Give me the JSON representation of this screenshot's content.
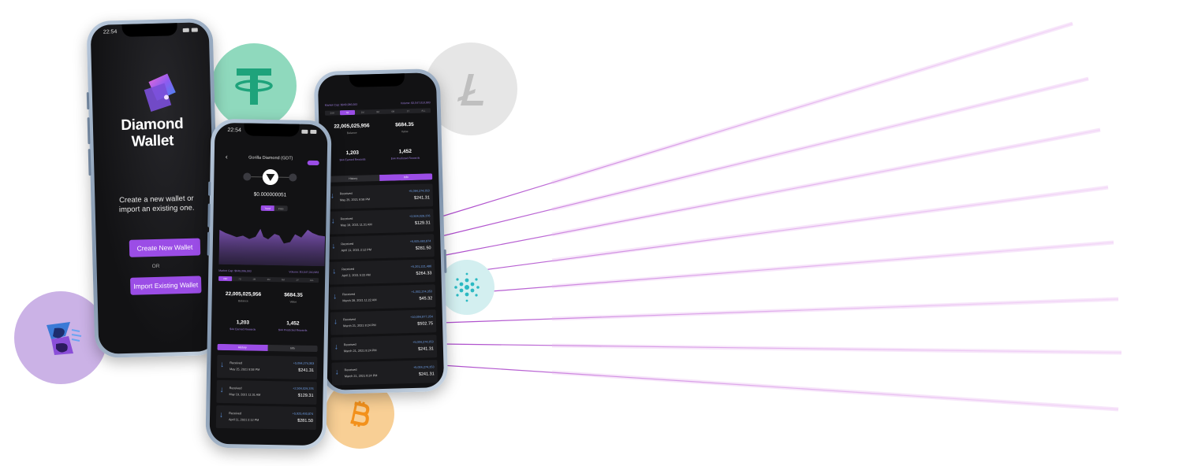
{
  "colors": {
    "accent": "#9b4de6",
    "ray": "#c65bd2",
    "tether": "#8fd9bd",
    "litecoin": "#e3e3e3",
    "bitcoin": "#f7c77d",
    "cardano": "#d3eff0",
    "bubble_purple": "#cbb2e6"
  },
  "coins": [
    {
      "name": "tether-icon"
    },
    {
      "name": "litecoin-icon"
    },
    {
      "name": "bitcoin-icon"
    },
    {
      "name": "cardano-icon"
    },
    {
      "name": "brand-icon"
    }
  ],
  "phone1": {
    "time": "22:54",
    "brand_line1": "Diamond",
    "brand_line2": "Wallet",
    "tagline_line1": "Create a new wallet or",
    "tagline_line2": "import an existing one.",
    "create_label": "Create New Wallet",
    "or_label": "OR",
    "import_label": "Import Existing Wallet"
  },
  "phone2": {
    "time": "22:54",
    "back": "‹",
    "title": "Gorilla Diamond (GDT)",
    "value": "$0.000000051",
    "toggle": [
      "Trend",
      "Price"
    ],
    "market_cap": "Market Cap: $849,086,083",
    "volume": "Volume: $3,547,010,983",
    "timeframes": [
      "24H",
      "7D",
      "1M",
      "3M",
      "6M",
      "1Y",
      "ALL"
    ],
    "balance_value": "22,005,025,956",
    "balance_label": "Balance",
    "value_value": "$684.35",
    "value_label": "Value",
    "earned_value": "1,203",
    "earned_label": "$44 Earned Rewards",
    "predicted_value": "1,452",
    "predicted_label": "$44 Predicted Rewards",
    "tabs": [
      "History",
      "Info"
    ],
    "transactions": [
      {
        "kind": "Received",
        "date": "May 25, 2021 9:58 PM",
        "amount": "+5,094,274,353",
        "usd": "$241.31"
      },
      {
        "kind": "Received",
        "date": "May 19, 2021 11:31 AM",
        "amount": "+2,504,029,376",
        "usd": "$129.31"
      },
      {
        "kind": "Received",
        "date": "April 11, 2021 2:12 PM",
        "amount": "+5,925,493,874",
        "usd": "$281.50"
      }
    ]
  },
  "phone3": {
    "market_cap": "Market Cap: $849,086,083",
    "volume": "Volume: $3,547,010,983",
    "timeframes": [
      "24H",
      "7D",
      "1M",
      "3M",
      "6M",
      "1Y",
      "ALL"
    ],
    "balance_value": "22,005,025,956",
    "balance_label": "Balance",
    "value_value": "$684.35",
    "value_label": "Value",
    "earned_value": "1,203",
    "earned_label": "$44 Earned Rewards",
    "predicted_value": "1,452",
    "predicted_label": "$44 Predicted Rewards",
    "tabs": [
      "History",
      "Info"
    ],
    "transactions": [
      {
        "kind": "Received",
        "date": "May 25, 2021 9:58 PM",
        "amount": "+5,094,274,353",
        "usd": "$241.31"
      },
      {
        "kind": "Received",
        "date": "May 19, 2021 11:31 AM",
        "amount": "+2,504,029,376",
        "usd": "$129.31"
      },
      {
        "kind": "Received",
        "date": "April 11, 2021 2:12 PM",
        "amount": "+5,925,493,874",
        "usd": "$281.50"
      },
      {
        "kind": "Received",
        "date": "April 2, 2021 5:22 AM",
        "amount": "+5,201,221,486",
        "usd": "$264.33"
      },
      {
        "kind": "Received",
        "date": "March 28, 2021 11:22 AM",
        "amount": "+1,002,274,353",
        "usd": "$45.32"
      },
      {
        "kind": "Received",
        "date": "March 21, 2021 8:24 PM",
        "amount": "+10,004,877,354",
        "usd": "$502.75"
      },
      {
        "kind": "Received",
        "date": "March 21, 2021 8:24 PM",
        "amount": "+5,004,274,353",
        "usd": "$241.31"
      },
      {
        "kind": "Received",
        "date": "March 21, 2021 8:24 PM",
        "amount": "+5,004,274,353",
        "usd": "$241.31"
      }
    ]
  }
}
